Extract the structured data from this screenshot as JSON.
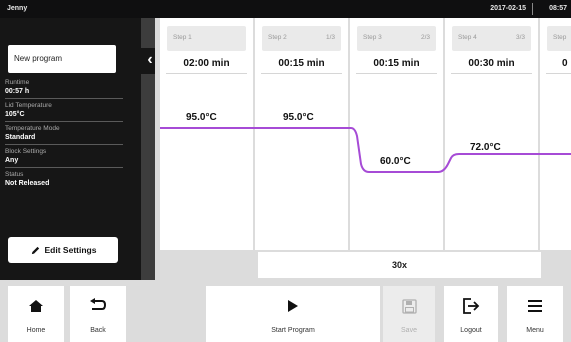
{
  "topbar": {
    "user": "Jenny",
    "date": "2017-02-15",
    "time": "08:57"
  },
  "sidebar": {
    "program_name": "New program",
    "collapse_glyph": "‹",
    "info": [
      {
        "label": "Runtime",
        "value": "00:57 h"
      },
      {
        "label": "Lid Temperature",
        "value": "105°C"
      },
      {
        "label": "Temperature Mode",
        "value": "Standard"
      },
      {
        "label": "Block Settings",
        "value": "Any"
      },
      {
        "label": "Status",
        "value": "Not Released"
      }
    ],
    "edit_button": "Edit Settings"
  },
  "steps": [
    {
      "name": "Step 1",
      "counter": "",
      "duration": "02:00 min",
      "temperature": "95.0°C"
    },
    {
      "name": "Step 2",
      "counter": "1/3",
      "duration": "00:15 min",
      "temperature": "95.0°C"
    },
    {
      "name": "Step 3",
      "counter": "2/3",
      "duration": "00:15 min",
      "temperature": "60.0°C"
    },
    {
      "name": "Step 4",
      "counter": "3/3",
      "duration": "00:30 min",
      "temperature": "72.0°C"
    },
    {
      "name": "Step",
      "counter": "",
      "duration": "0",
      "temperature": ""
    }
  ],
  "cycles_label": "30x",
  "curve_color": "#a64bd6",
  "bottombar": {
    "home": "Home",
    "back": "Back",
    "start": "Start Program",
    "save": "Save",
    "logout": "Logout",
    "menu": "Menu"
  }
}
